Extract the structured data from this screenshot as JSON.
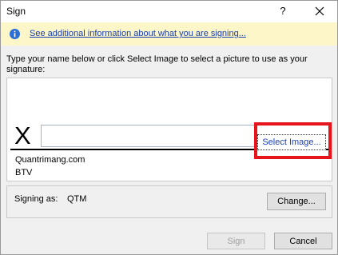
{
  "dialog": {
    "title": "Sign",
    "help_label": "?",
    "close_label": "×"
  },
  "infobar": {
    "icon": "info-icon",
    "link_text": "See additional information about what you are signing..."
  },
  "prompt": {
    "text": "Type your name below or click Select Image to select a picture to use as your signature:"
  },
  "signature": {
    "x_mark": "X",
    "input_value": "",
    "select_image_label": "Select Image...",
    "signer_name": "Quantrimang.com",
    "signer_title": "BTV"
  },
  "signing_as": {
    "label": "Signing as:",
    "value": "QTM",
    "change_label": "Change..."
  },
  "footer": {
    "sign_label": "Sign",
    "cancel_label": "Cancel"
  },
  "colors": {
    "highlight": "#e8141c",
    "link": "#1a3fb0",
    "infobar_bg": "#fdf6c8"
  }
}
